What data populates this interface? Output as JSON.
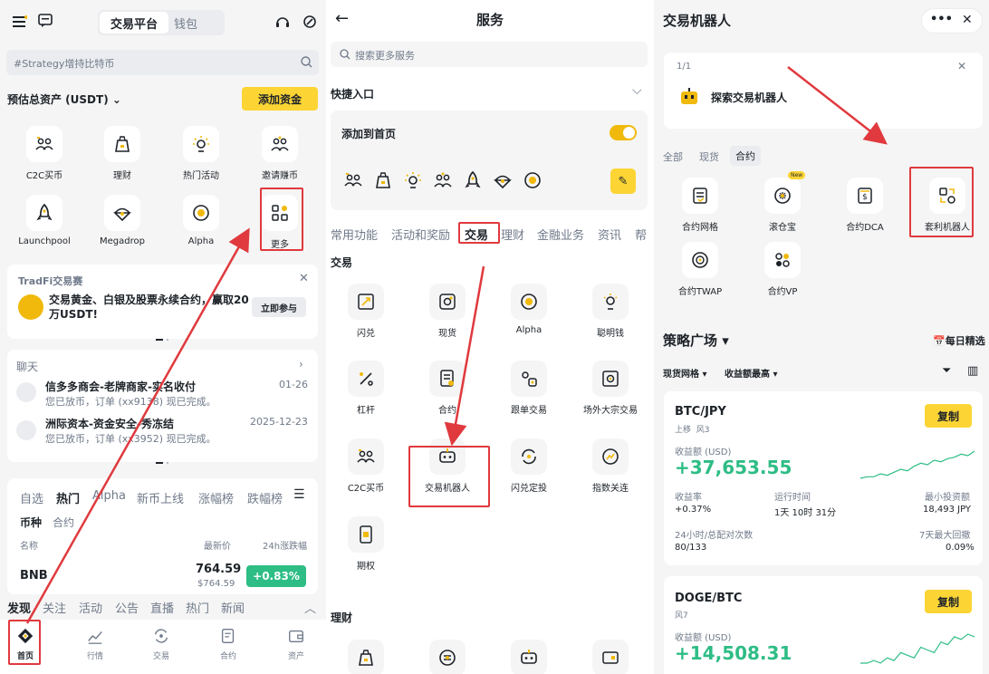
{
  "p1": {
    "header": {
      "tab_platform": "交易平台",
      "tab_wallet": "钱包"
    },
    "search": {
      "placeholder": "#Strategy增持比特币"
    },
    "assets": {
      "label": "预估总资产 (USDT)",
      "add_funds": "添加资金"
    },
    "quick": [
      "C2C买币",
      "理财",
      "热门活动",
      "邀请赚币",
      "Launchpool",
      "Megadrop",
      "Alpha",
      "更多"
    ],
    "tradfi": {
      "title": "TradFi交易赛",
      "text_line1": "交易黄金、白银及股票永续合约，赢取20",
      "text_line2": "万USDT!",
      "join": "立即参与"
    },
    "chat": {
      "title": "聊天",
      "items": [
        {
          "name": "信多多商会-老牌商家-实名收付",
          "date": "01-26",
          "msg": "您已放币，订单 (xx9138) 现已完成。"
        },
        {
          "name": "洲际资本-资金安全-秀冻结",
          "date": "2025-12-23",
          "msg": "您已放币，订单 (xx3952) 现已完成。"
        }
      ]
    },
    "market": {
      "tabs": [
        "自选",
        "热门",
        "Alpha",
        "新币上线",
        "涨幅榜",
        "跌幅榜"
      ],
      "subtabs": [
        "币种",
        "合约"
      ],
      "col_name": "名称",
      "col_price": "最新价",
      "col_change": "24h涨跌幅",
      "row": {
        "symbol": "BNB",
        "price": "764.59",
        "price_sub": "$764.59",
        "change": "+0.83%"
      }
    },
    "discover": [
      "发现",
      "关注",
      "活动",
      "公告",
      "直播",
      "热门",
      "新闻"
    ],
    "nav": [
      "首页",
      "行情",
      "交易",
      "合约",
      "资产"
    ]
  },
  "p2": {
    "title": "服务",
    "search": {
      "placeholder": "搜索更多服务"
    },
    "quick_entry": "快捷入口",
    "add_home": "添加到首页",
    "tabs": [
      "常用功能",
      "活动和奖励",
      "交易",
      "理财",
      "金融业务",
      "资讯",
      "帮"
    ],
    "section_trade": "交易",
    "items": [
      "闪兑",
      "现货",
      "Alpha",
      "聪明钱",
      "杠杆",
      "合约",
      "跟单交易",
      "场外大宗交易",
      "C2C买币",
      "交易机器人",
      "闪兑定投",
      "指数关连",
      "期权"
    ],
    "section_finance": "理财"
  },
  "p3": {
    "title": "交易机器人",
    "notice": {
      "page": "1/1",
      "text": "探索交易机器人"
    },
    "filters": [
      "全部",
      "现货",
      "合约"
    ],
    "bots": [
      "合约网格",
      "滚仓宝",
      "合约DCA",
      "套利机器人",
      "合约TWAP",
      "合约VP"
    ],
    "new_badge": "New",
    "plaza": {
      "title": "策略广场",
      "daily": "每日精选",
      "filter1": "现货网格",
      "filter2": "收益额最高"
    },
    "card1": {
      "pair": "BTC/JPY",
      "tag1": "上移",
      "tag2": "风3",
      "copy": "复制",
      "profit_label": "收益额 (USD)",
      "profit": "+37,653.55",
      "rate_label": "收益率",
      "rate": "+0.37%",
      "runtime_label": "运行时间",
      "runtime": "1天 10时 31分",
      "min_label": "最小投资额",
      "min": "18,493 JPY",
      "trades_label": "24小时/总配对次数",
      "trades": "80/133",
      "dd_label": "7天最大回撤",
      "dd": "0.09%"
    },
    "card2": {
      "pair": "DOGE/BTC",
      "tag": "风7",
      "copy": "复制",
      "profit_label": "收益额 (USD)",
      "profit": "+14,508.31"
    }
  },
  "colors": {
    "accent": "#fcd535",
    "green": "#2ebd85",
    "red_box": "#e0393e",
    "text": "#1e2329",
    "muted": "#707a8a"
  },
  "chart_sparkline_1": [
    2,
    3,
    3,
    5,
    4,
    6,
    8,
    7,
    10,
    12,
    11,
    14,
    13,
    15,
    16,
    18,
    17,
    20
  ],
  "chart_sparkline_2": [
    2,
    2,
    3,
    2,
    4,
    3,
    6,
    5,
    4,
    8,
    7,
    6,
    10,
    9,
    12,
    11,
    13,
    12
  ]
}
